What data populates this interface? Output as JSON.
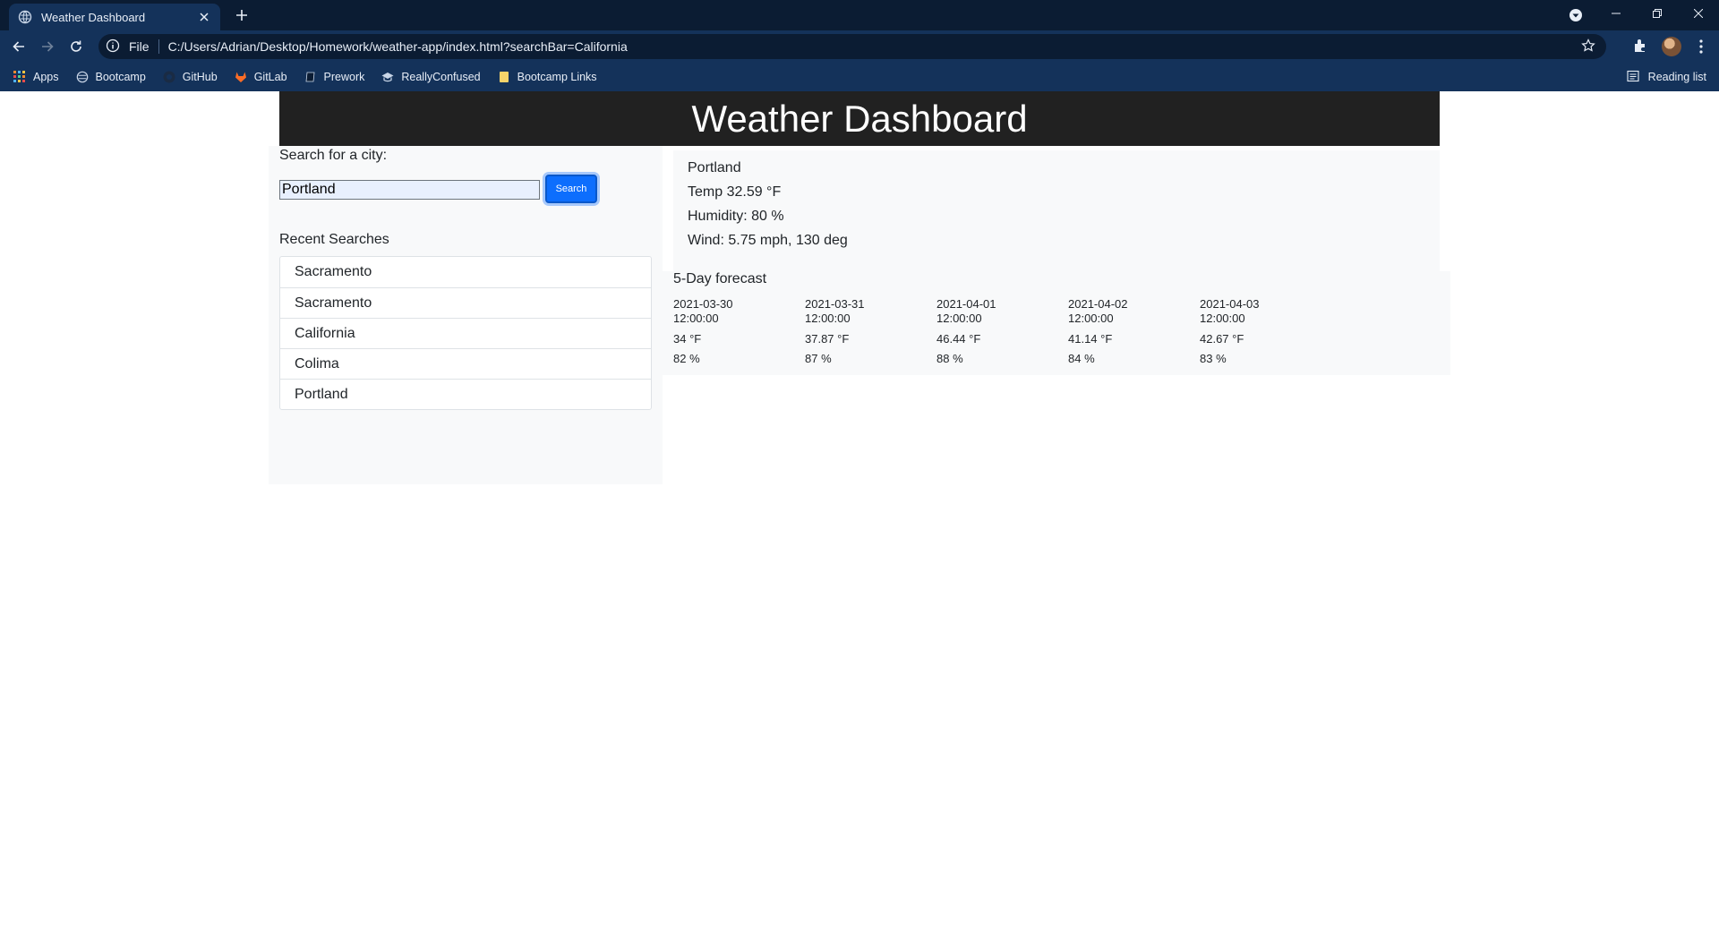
{
  "browser": {
    "tab_title": "Weather Dashboard",
    "url_scheme": "File",
    "url": "C:/Users/Adrian/Desktop/Homework/weather-app/index.html?searchBar=California",
    "bookmarks": [
      "Apps",
      "Bootcamp",
      "GitHub",
      "GitLab",
      "Prework",
      "ReallyConfused",
      "Bootcamp Links"
    ],
    "reading_list": "Reading list"
  },
  "page": {
    "title": "Weather Dashboard",
    "search_label": "Search for a city:",
    "search_value": "Portland",
    "search_button": "Search",
    "recent_title": "Recent Searches",
    "recent": [
      "Sacramento",
      "Sacramento",
      "California",
      "Colima",
      "Portland"
    ]
  },
  "current": {
    "city": "Portland",
    "temp": "Temp 32.59 °F",
    "humidity": "Humidity: 80 %",
    "wind": "Wind: 5.75 mph, 130 deg"
  },
  "forecast": {
    "title": "5-Day forecast",
    "days": [
      {
        "date": "2021-03-30\n12:00:00",
        "temp": "34 °F",
        "humidity": "82 %"
      },
      {
        "date": "2021-03-31\n12:00:00",
        "temp": "37.87 °F",
        "humidity": "87 %"
      },
      {
        "date": "2021-04-01\n12:00:00",
        "temp": "46.44 °F",
        "humidity": "88 %"
      },
      {
        "date": "2021-04-02\n12:00:00",
        "temp": "41.14 °F",
        "humidity": "84 %"
      },
      {
        "date": "2021-04-03\n12:00:00",
        "temp": "42.67 °F",
        "humidity": "83 %"
      }
    ]
  }
}
